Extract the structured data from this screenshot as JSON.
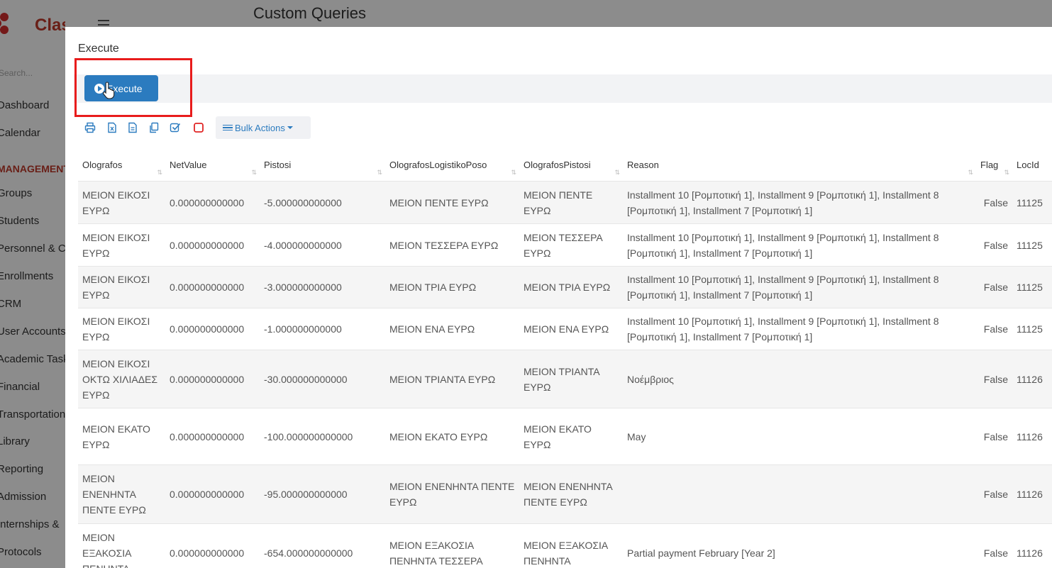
{
  "app": {
    "logo_text": "Classter",
    "page_title": "Custom Queries",
    "search_placeholder": "Search...",
    "sidebar": {
      "items_top": [
        "Dashboard",
        "Calendar"
      ],
      "section": "MANAGEMENT",
      "items": [
        "Groups",
        "Students",
        "Personnel & Courses",
        "Enrollments",
        "CRM",
        "User Accounts",
        "Academic Tasks",
        "Financial",
        "Transportation",
        "Library",
        "Reporting",
        "Admission",
        "Internships &",
        "Protocols"
      ]
    }
  },
  "modal": {
    "title": "Execute",
    "execute_label": "Execute",
    "bulk_actions_label": "Bulk Actions",
    "toolbar_icons": [
      "print-icon",
      "excel-icon",
      "csv-icon",
      "copy-icon",
      "select-all-icon",
      "deselect-icon"
    ]
  },
  "table": {
    "columns": [
      "Olografos",
      "NetValue",
      "Pistosi",
      "OlografosLogistikoPoso",
      "OlografosPistosi",
      "Reason",
      "Flag",
      "LocId"
    ],
    "rows": [
      [
        "ΜΕΙΟΝ ΕΙΚΟΣΙ ΕΥΡΩ",
        "0.000000000000",
        "-5.000000000000",
        "ΜΕΙΟΝ ΠΕΝΤΕ ΕΥΡΩ",
        "ΜΕΙΟΝ ΠΕΝΤΕ ΕΥΡΩ",
        "Installment 10 [Ρομποτική 1], Installment 9 [Ρομποτική 1], Installment 8 [Ρομποτική 1], Installment 7 [Ρομποτική 1]",
        "False",
        "11125"
      ],
      [
        "ΜΕΙΟΝ ΕΙΚΟΣΙ ΕΥΡΩ",
        "0.000000000000",
        "-4.000000000000",
        "ΜΕΙΟΝ ΤΕΣΣΕΡΑ ΕΥΡΩ",
        "ΜΕΙΟΝ ΤΕΣΣΕΡΑ ΕΥΡΩ",
        "Installment 10 [Ρομποτική 1], Installment 9 [Ρομποτική 1], Installment 8 [Ρομποτική 1], Installment 7 [Ρομποτική 1]",
        "False",
        "11125"
      ],
      [
        "ΜΕΙΟΝ ΕΙΚΟΣΙ ΕΥΡΩ",
        "0.000000000000",
        "-3.000000000000",
        "ΜΕΙΟΝ ΤΡΙΑ ΕΥΡΩ",
        "ΜΕΙΟΝ ΤΡΙΑ ΕΥΡΩ",
        "Installment 10 [Ρομποτική 1], Installment 9 [Ρομποτική 1], Installment 8 [Ρομποτική 1], Installment 7 [Ρομποτική 1]",
        "False",
        "11125"
      ],
      [
        "ΜΕΙΟΝ ΕΙΚΟΣΙ ΕΥΡΩ",
        "0.000000000000",
        "-1.000000000000",
        "ΜΕΙΟΝ ΕΝΑ ΕΥΡΩ",
        "ΜΕΙΟΝ ΕΝΑ ΕΥΡΩ",
        "Installment 10 [Ρομποτική 1], Installment 9 [Ρομποτική 1], Installment 8 [Ρομποτική 1], Installment 7 [Ρομποτική 1]",
        "False",
        "11125"
      ],
      [
        "ΜΕΙΟΝ ΕΙΚΟΣΙ ΟΚΤΩ ΧΙΛΙΑΔΕΣ ΕΥΡΩ",
        "0.000000000000",
        "-30.000000000000",
        "ΜΕΙΟΝ ΤΡΙΑΝΤΑ ΕΥΡΩ",
        "ΜΕΙΟΝ ΤΡΙΑΝΤΑ ΕΥΡΩ",
        "Νοέμβριος",
        "False",
        "11126"
      ],
      [
        "ΜΕΙΟΝ ΕΚΑΤΟ ΕΥΡΩ",
        "0.000000000000",
        "-100.000000000000",
        "ΜΕΙΟΝ ΕΚΑΤΟ ΕΥΡΩ",
        "ΜΕΙΟΝ ΕΚΑΤΟ ΕΥΡΩ",
        "May",
        "False",
        "11126"
      ],
      [
        "ΜΕΙΟΝ ΕΝΕΝΗΝΤΑ ΠΕΝΤΕ ΕΥΡΩ",
        "0.000000000000",
        "-95.000000000000",
        "ΜΕΙΟΝ ΕΝΕΝΗΝΤΑ ΠΕΝΤΕ ΕΥΡΩ",
        "ΜΕΙΟΝ ΕΝΕΝΗΝΤΑ ΠΕΝΤΕ ΕΥΡΩ",
        "",
        "False",
        "11126"
      ],
      [
        "ΜΕΙΟΝ ΕΞΑΚΟΣΙΑ ΠΕΝΗΝΤΑ",
        "0.000000000000",
        "-654.000000000000",
        "ΜΕΙΟΝ ΕΞΑΚΟΣΙΑ ΠΕΝΗΝΤΑ ΤΕΣΣΕΡΑ",
        "ΜΕΙΟΝ ΕΞΑΚΟΣΙΑ ΠΕΝΗΝΤΑ",
        "Partial payment February [Year 2]",
        "False",
        "11126"
      ]
    ]
  },
  "colors": {
    "accent": "#2b7bbf",
    "highlight": "#e81c1c",
    "brand": "#c0392b"
  }
}
